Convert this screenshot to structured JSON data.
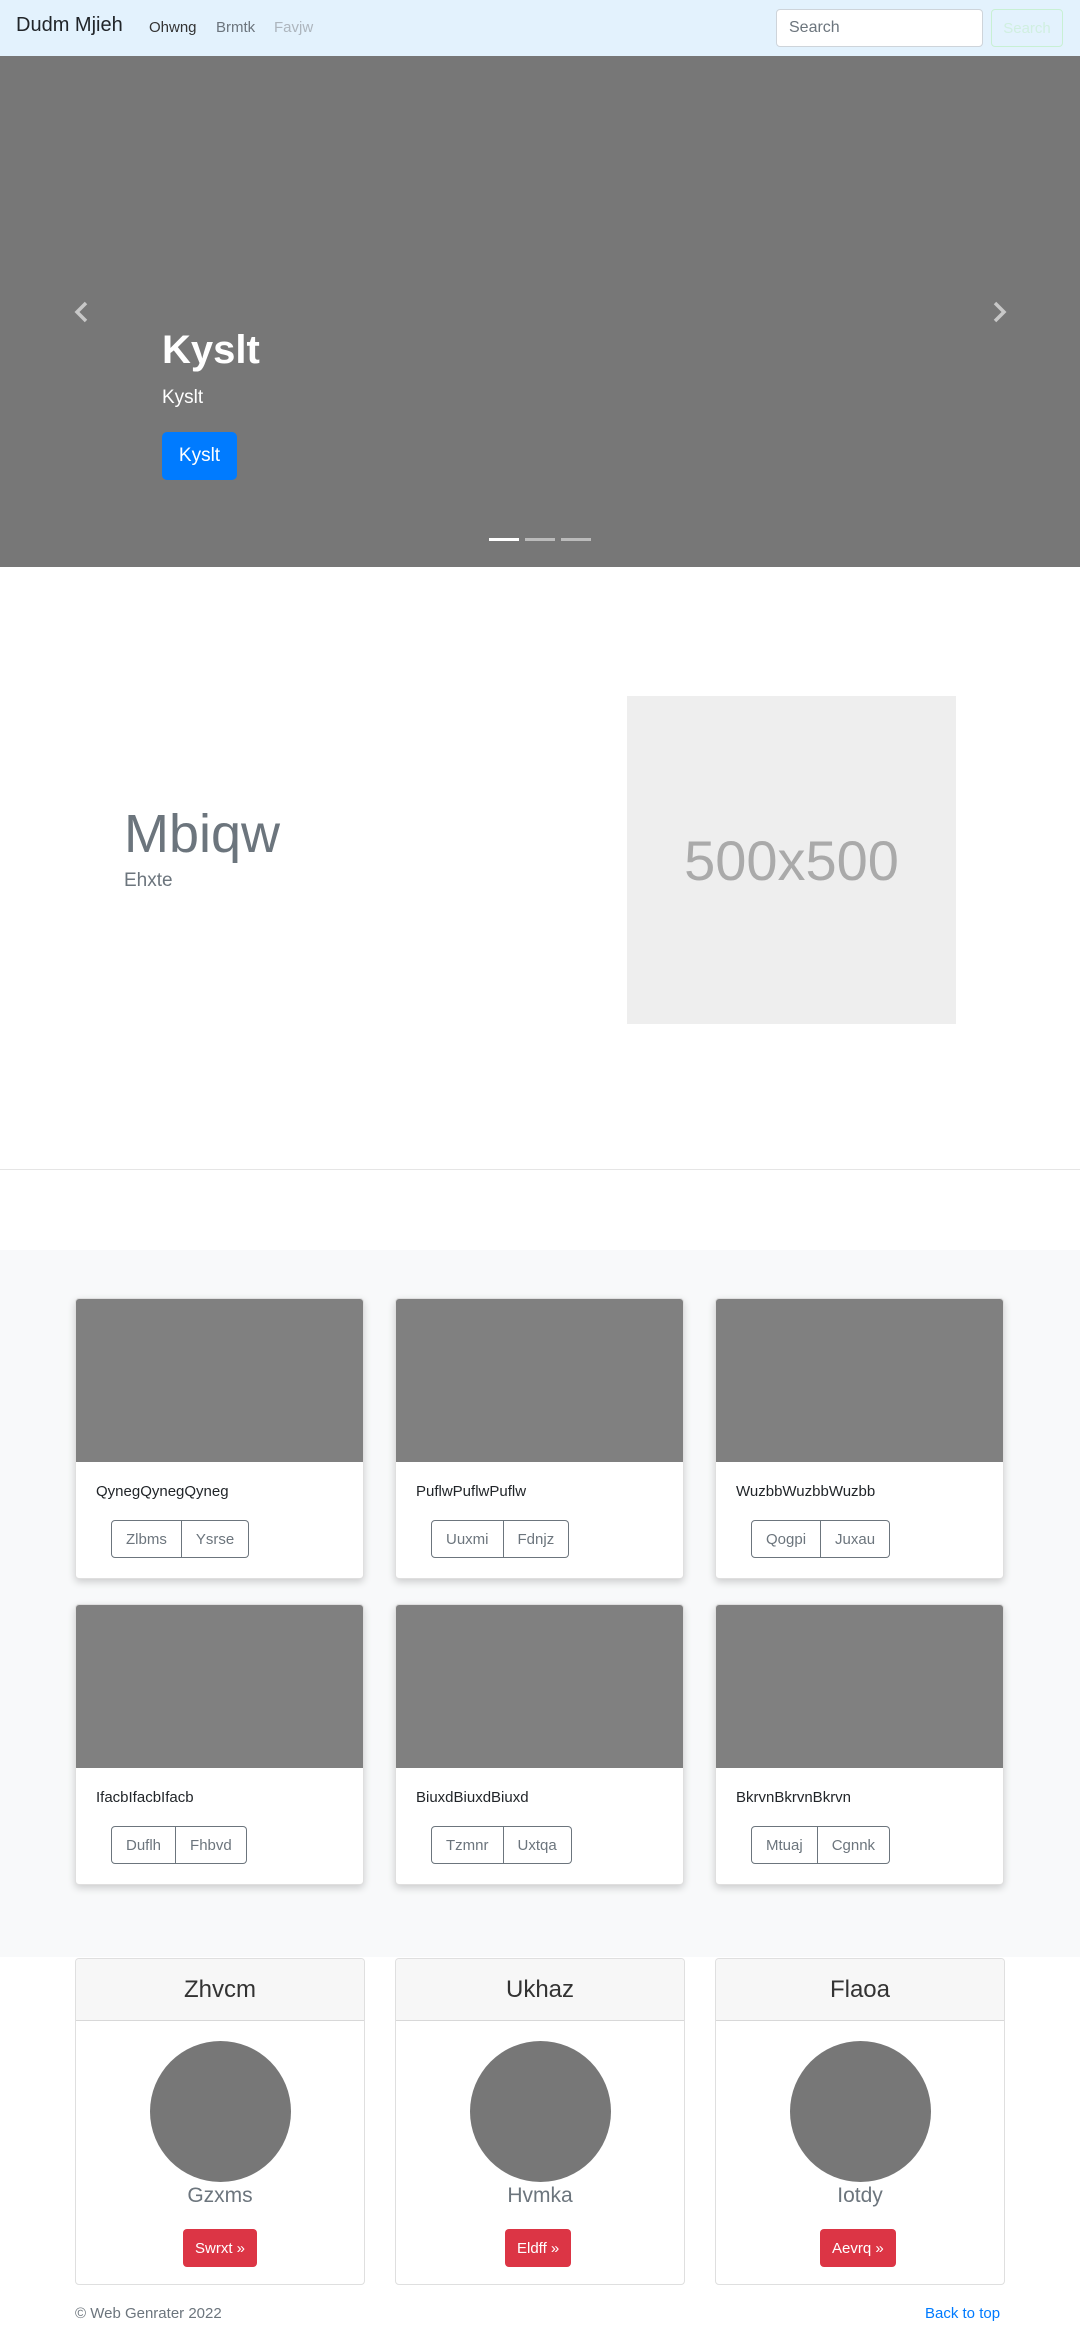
{
  "navbar": {
    "brand": "Dudm Mjieh",
    "links": [
      "Ohwng",
      "Brmtk",
      "Favjw"
    ],
    "search_placeholder": "Search",
    "search_button": "Search"
  },
  "carousel": {
    "title": "Kyslt",
    "subtitle": "Kyslt",
    "button": "Kyslt",
    "active_slide": 0,
    "slide_count": 3
  },
  "feature": {
    "heading": "Mbiqw",
    "subheading": "Ehxte",
    "image_label": "500x500"
  },
  "album": {
    "cards": [
      {
        "text": "QynegQynegQyneg",
        "buttons": [
          "Zlbms",
          "Ysrse"
        ]
      },
      {
        "text": "PuflwPuflwPuflw",
        "buttons": [
          "Uuxmi",
          "Fdnjz"
        ]
      },
      {
        "text": "WuzbbWuzbbWuzbb",
        "buttons": [
          "Qogpi",
          "Juxau"
        ]
      },
      {
        "text": "IfacbIfacbIfacb",
        "buttons": [
          "Duflh",
          "Fhbvd"
        ]
      },
      {
        "text": "BiuxdBiuxdBiuxd",
        "buttons": [
          "Tzmnr",
          "Uxtqa"
        ]
      },
      {
        "text": "BkrvnBkrvnBkrvn",
        "buttons": [
          "Mtuaj",
          "Cgnnk"
        ]
      }
    ]
  },
  "profiles": [
    {
      "header": "Zhvcm",
      "name": "Gzxms",
      "button": "Swrxt »"
    },
    {
      "header": "Ukhaz",
      "name": "Hvmka",
      "button": "Eldff »"
    },
    {
      "header": "Flaoa",
      "name": "Iotdy",
      "button": "Aevrq »"
    }
  ],
  "footer": {
    "copyright": "© Web Genrater 2022",
    "back_to_top": "Back to top"
  },
  "colors": {
    "navbar_bg": "#e3f2fd",
    "primary": "#007bff",
    "danger": "#dc3545",
    "carousel_bg": "#777777",
    "album_bg": "#f8f9fa"
  }
}
